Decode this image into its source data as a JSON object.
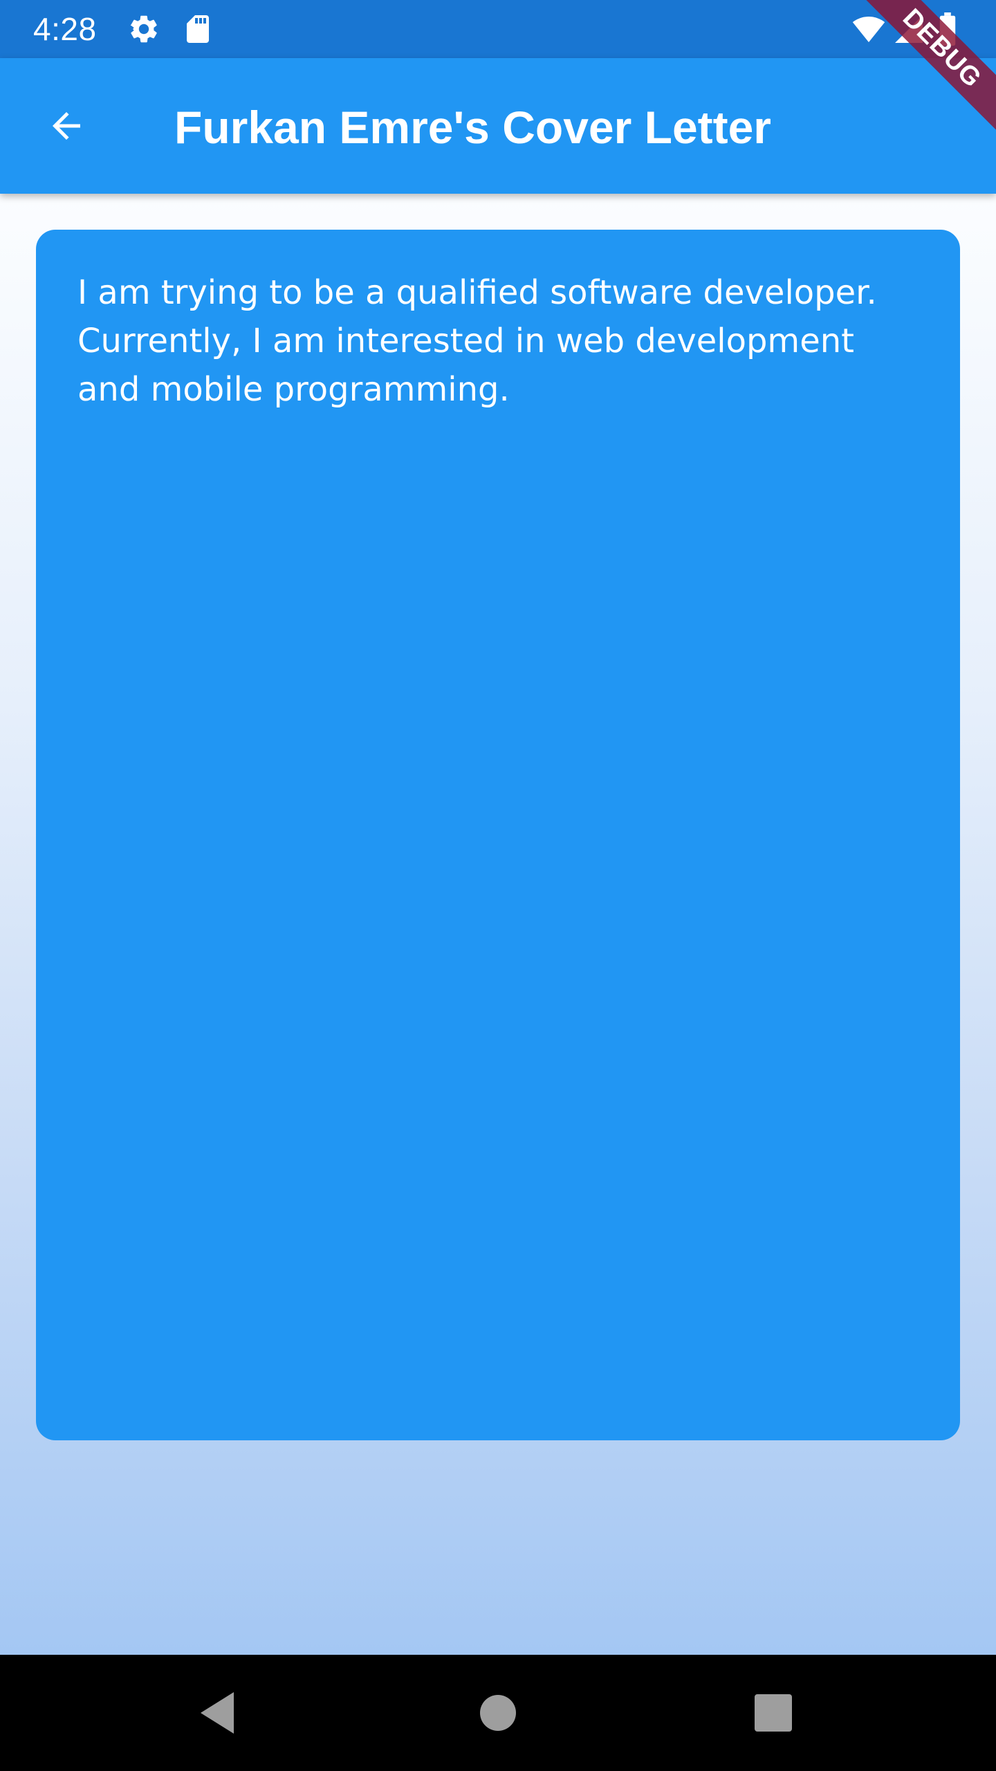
{
  "status_bar": {
    "time": "4:28",
    "left_icons": [
      "gear-icon",
      "sd-card-icon"
    ],
    "right_icons": [
      "wifi-icon",
      "signal-icon",
      "battery-icon"
    ]
  },
  "app_bar": {
    "back_icon": "arrow-back-icon",
    "title": "Furkan Emre's Cover Letter"
  },
  "debug_banner": {
    "label": "DEBUG"
  },
  "letter": {
    "text": "I am trying to be a qualified software developer. Currently, I am interested in web development and mobile programming."
  },
  "nav_bar": {
    "buttons": [
      "back-triangle-icon",
      "home-circle-icon",
      "recents-square-icon"
    ]
  },
  "colors": {
    "status_bar": "#1976D2",
    "app_bar": "#2196F3",
    "card": "#2196F3",
    "debug_ribbon": "#8C1432",
    "nav_bar": "#000000"
  }
}
